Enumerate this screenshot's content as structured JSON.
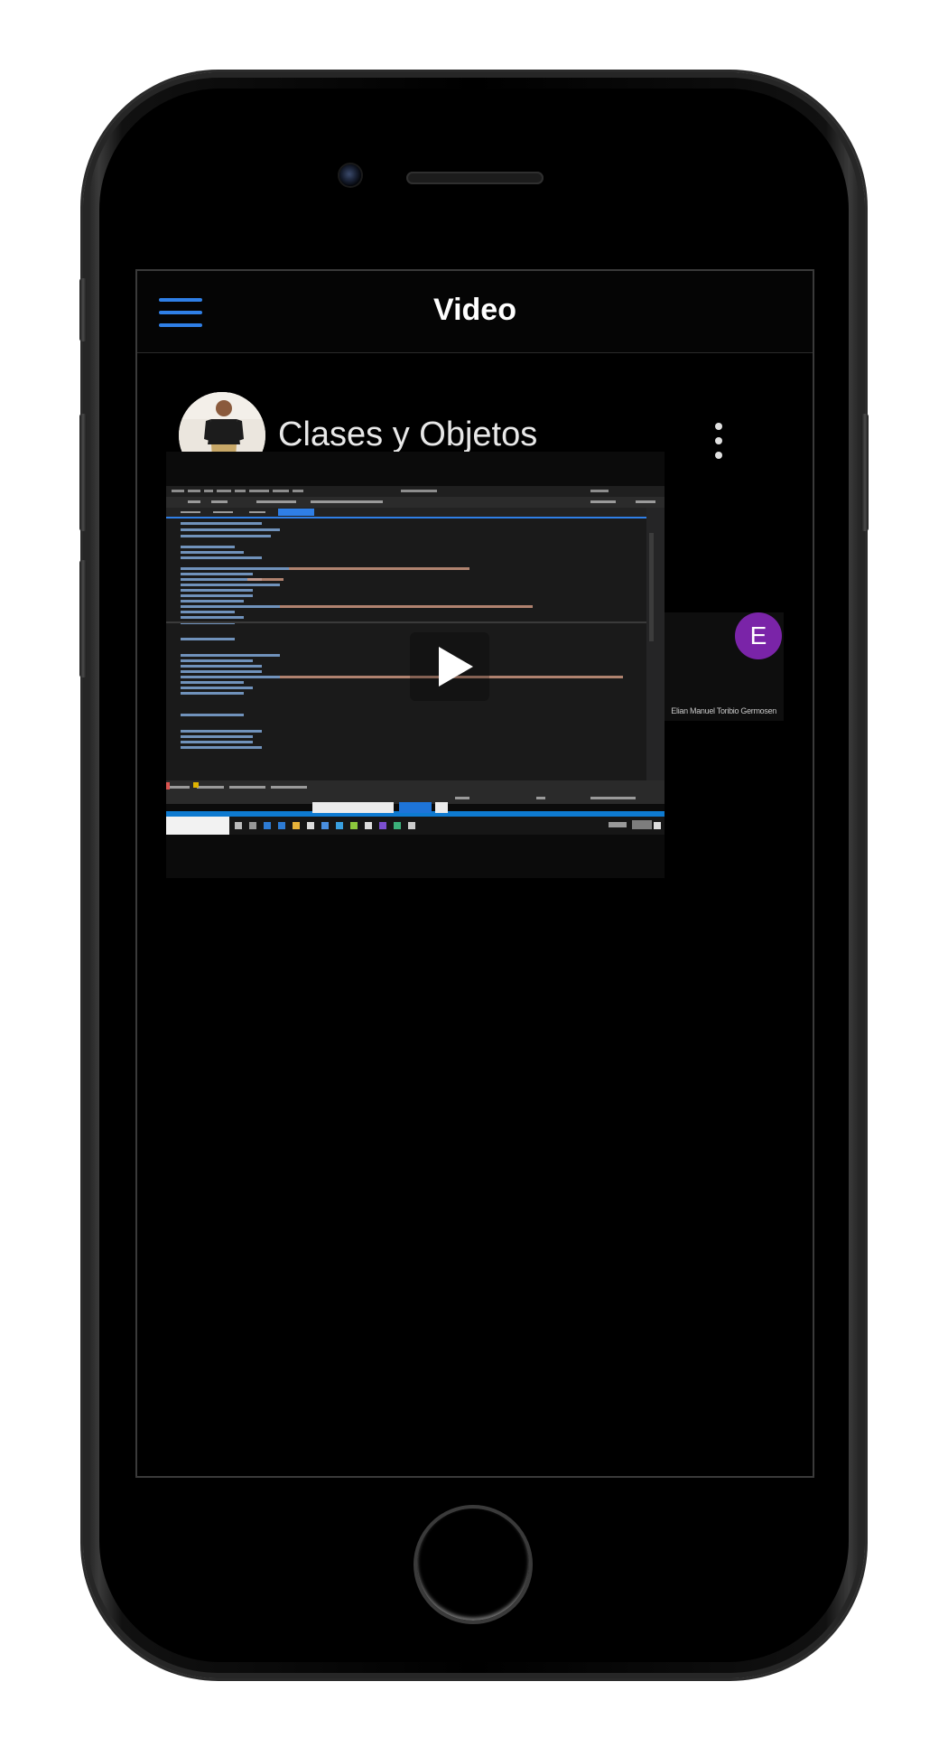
{
  "app": {
    "title": "Video",
    "accent_color": "#2f7fe6"
  },
  "video": {
    "title": "Clases y Objetos",
    "menu_icon": "more-vertical-icon",
    "play_icon": "play-icon"
  },
  "participant": {
    "initial": "E",
    "name": "Elian Manuel Toribio Germosen",
    "color": "#7a24a8"
  }
}
